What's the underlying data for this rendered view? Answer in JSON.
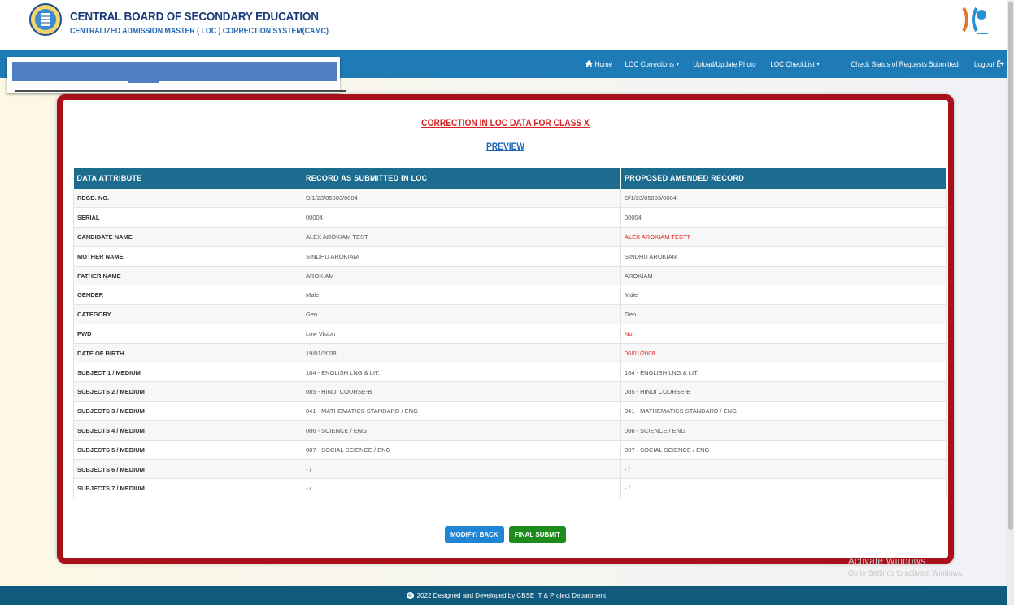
{
  "header": {
    "title": "CENTRAL BOARD OF SECONDARY EDUCATION",
    "subtitle": "CENTRALIZED ADMISSION MASTER ( LOC ) CORRECTION SYSTEM(CAMC)"
  },
  "nav": {
    "home": "Home",
    "loc_corrections": "LOC Corrections",
    "upload_photo": "Upload/Update Photo",
    "loc_checklist": "LOC CheckList",
    "check_status": "Check Status of Requests Submitted",
    "logout": "Logout"
  },
  "card": {
    "title": "CORRECTION IN LOC DATA FOR CLASS X",
    "subtitle": "PREVIEW",
    "columns": [
      "DATA ATTRIBUTE",
      "RECORD AS SUBMITTED IN LOC",
      "PROPOSED AMENDED RECORD"
    ],
    "rows": [
      {
        "attr": "REGD. NO.",
        "orig": "D/1/23/85003/0004",
        "new": "D/1/23/85003/0004",
        "changed": false
      },
      {
        "attr": "SERIAL",
        "orig": "00004",
        "new": "00004",
        "changed": false
      },
      {
        "attr": "CANDIDATE NAME",
        "orig": "ALEX AROKIAM TEST",
        "new": "ALEX AROKIAM TESTT",
        "changed": true
      },
      {
        "attr": "MOTHER NAME",
        "orig": "SINDHU AROKIAM",
        "new": "SINDHU AROKIAM",
        "changed": false
      },
      {
        "attr": "FATHER NAME",
        "orig": "AROKIAM",
        "new": "AROKIAM",
        "changed": false
      },
      {
        "attr": "GENDER",
        "orig": "Male",
        "new": "Male",
        "changed": false
      },
      {
        "attr": "CATEGORY",
        "orig": "Gen",
        "new": "Gen",
        "changed": false
      },
      {
        "attr": "PWD",
        "orig": "Low Vision",
        "new": "No",
        "changed": true
      },
      {
        "attr": "DATE OF BIRTH",
        "orig": "19/01/2008",
        "new": "06/01/2008",
        "changed": true
      },
      {
        "attr": "SUBJECT 1 / MEDIUM",
        "orig": "184 - ENGLISH LNG & LIT.",
        "new": "184 - ENGLISH LNG & LIT.",
        "changed": false
      },
      {
        "attr": "SUBJECTS 2 / MEDIUM",
        "orig": "085 - HINDI COURSE-B",
        "new": "085 - HINDI COURSE-B",
        "changed": false
      },
      {
        "attr": "SUBJECTS 3 / MEDIUM",
        "orig": "041 - MATHEMATICS STANDARD / ENG",
        "new": "041 - MATHEMATICS STANDARD / ENG",
        "changed": false
      },
      {
        "attr": "SUBJECTS 4 / MEDIUM",
        "orig": "086 - SCIENCE / ENG",
        "new": "086 - SCIENCE / ENG",
        "changed": false
      },
      {
        "attr": "SUBJECTS 5 / MEDIUM",
        "orig": "087 - SOCIAL SCIENCE / ENG",
        "new": "087 - SOCIAL SCIENCE / ENG",
        "changed": false
      },
      {
        "attr": "SUBJECTS 6 / MEDIUM",
        "orig": "- /",
        "new": "- /",
        "changed": false
      },
      {
        "attr": "SUBJECTS 7 / MEDIUM",
        "orig": "- /",
        "new": "- /",
        "changed": false
      }
    ],
    "modify_button": "MODIFY/ BACK",
    "submit_button": "FINAL SUBMIT"
  },
  "watermark": {
    "line1": "Activate Windows",
    "line2": "Go to Settings to activate Windows."
  },
  "footer": {
    "text": "2022 Designed and Developed by CBSE IT & Project Department."
  },
  "colors": {
    "navbar": "#1e7bb5",
    "card_border": "#a8101a",
    "table_header": "#1c6c8f",
    "changed_value": "#e02020",
    "footer": "#105a7e"
  },
  "icons": {
    "home": "home-icon",
    "logout": "logout-icon",
    "caret": "caret-down-icon",
    "copyright": "copyright-icon"
  }
}
